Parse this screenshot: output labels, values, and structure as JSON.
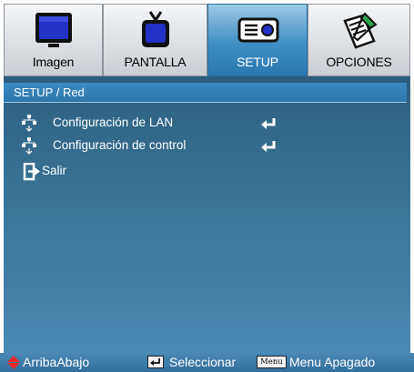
{
  "tabs": [
    {
      "label": "Imagen",
      "icon": "monitor-icon",
      "active": false
    },
    {
      "label": "PANTALLA",
      "icon": "tv-icon",
      "active": false
    },
    {
      "label": "SETUP",
      "icon": "projector-icon",
      "active": true
    },
    {
      "label": "OPCIONES",
      "icon": "options-notepad-icon",
      "active": false
    }
  ],
  "breadcrumb": "SETUP / Red",
  "menu_items": [
    {
      "label": "Configuración de LAN",
      "icon": "network-icon",
      "action": "enter-icon"
    },
    {
      "label": "Configuración de control",
      "icon": "network-icon",
      "action": "enter-icon"
    },
    {
      "label": "Salir",
      "icon": "exit-icon"
    }
  ],
  "footer": {
    "nav_label": "ArribaAbajo",
    "select_label": "Seleccionar",
    "menu_key": "Menu",
    "menu_label": "Menu Apagado"
  },
  "colors": {
    "active_tab": "#3f8fc4",
    "panel": "#2f6688",
    "footer": "#3a78a8",
    "nav_arrows": "#e32b2b"
  }
}
